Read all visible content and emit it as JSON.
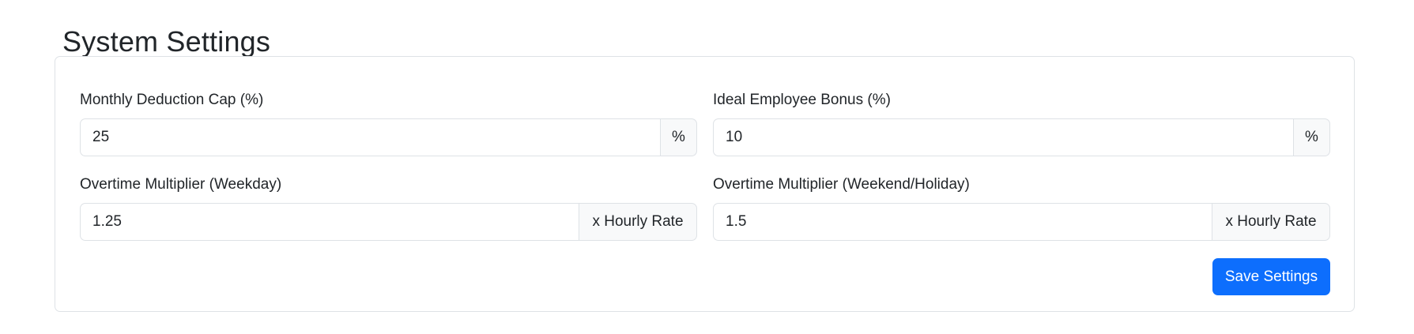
{
  "page": {
    "title": "System Settings"
  },
  "settings": {
    "deduction_cap": {
      "label": "Monthly Deduction Cap (%)",
      "value": "25",
      "addon": "%"
    },
    "ideal_bonus": {
      "label": "Ideal Employee Bonus (%)",
      "value": "10",
      "addon": "%"
    },
    "overtime_weekday": {
      "label": "Overtime Multiplier (Weekday)",
      "value": "1.25",
      "addon": "x Hourly Rate"
    },
    "overtime_weekend": {
      "label": "Overtime Multiplier (Weekend/Holiday)",
      "value": "1.5",
      "addon": "x Hourly Rate"
    }
  },
  "actions": {
    "save_label": "Save Settings"
  },
  "colors": {
    "primary": "#0d6efd",
    "border": "#dee2e6",
    "addon_bg": "#f8f9fa",
    "text": "#212529"
  }
}
